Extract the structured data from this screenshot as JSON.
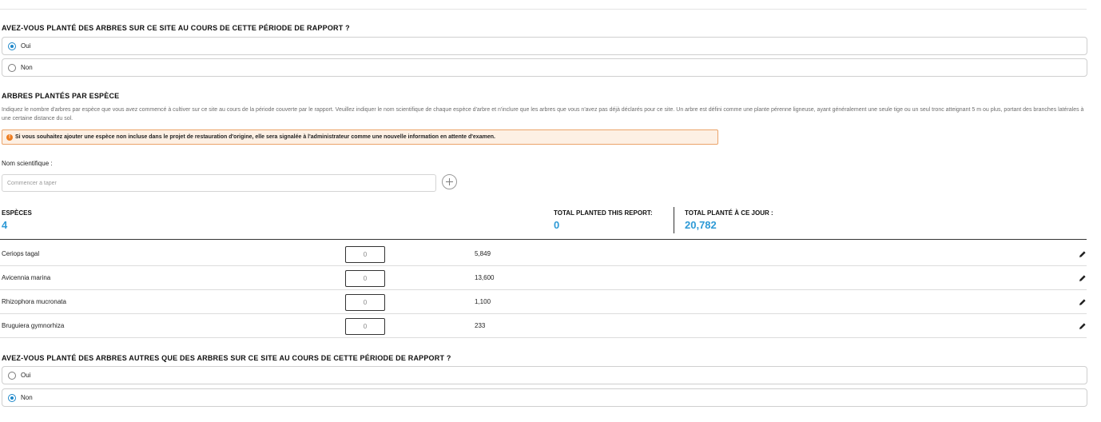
{
  "question1": {
    "title": "AVEZ-VOUS PLANTÉ DES ARBRES SUR CE SITE AU COURS DE CETTE PÉRIODE DE RAPPORT ?",
    "options": [
      {
        "label": "Oui",
        "checked": true
      },
      {
        "label": "Non",
        "checked": false
      }
    ]
  },
  "species_section": {
    "title": "ARBRES PLANTÉS PAR ESPÈCE",
    "description": "Indiquez le nombre d'arbres par espèce que vous avez commencé à cultiver sur ce site au cours de la période couverte par le rapport. Veuillez indiquer le nom scientifique de chaque espèce d'arbre et n'inclure que les arbres que vous n'avez pas déjà déclarés pour ce site. Un arbre est défini comme une plante pérenne ligneuse, ayant généralement une seule tige ou un seul tronc atteignant 5 m ou plus, portant des branches latérales à une certaine distance du sol.",
    "notice": "Si vous souhaitez ajouter une espèce non incluse dans le projet de restauration d'origine, elle sera signalée à l'administrateur comme une nouvelle information en attente d'examen.",
    "notice_icon": "warning-icon",
    "field_label": "Nom scientifique :",
    "search_placeholder": "Commencer à taper",
    "add_icon": "plus-circle-icon"
  },
  "stats": {
    "species_label": "ESPÈCES",
    "species_value": "4",
    "report_label": "TOTAL PLANTED THIS REPORT:",
    "report_value": "0",
    "todate_label": "TOTAL PLANTÉ À CE JOUR :",
    "todate_value": "20,782"
  },
  "species_rows": [
    {
      "name": "Ceriops tagal",
      "input": "0",
      "total": "5,849"
    },
    {
      "name": "Avicennia marina",
      "input": "0",
      "total": "13,600"
    },
    {
      "name": "Rhizophora mucronata",
      "input": "0",
      "total": "1,100"
    },
    {
      "name": "Bruguiera gymnorhiza",
      "input": "0",
      "total": "233"
    }
  ],
  "question2": {
    "title": "AVEZ-VOUS PLANTÉ DES ARBRES AUTRES QUE DES ARBRES SUR CE SITE AU COURS DE CETTE PÉRIODE DE RAPPORT ?",
    "options": [
      {
        "label": "Oui",
        "checked": false
      },
      {
        "label": "Non",
        "checked": true
      }
    ]
  },
  "colors": {
    "accent": "#1d87c9",
    "stat_value": "#2e9ad6",
    "notice_bg": "#fdf0e4",
    "notice_border": "#eba46a",
    "notice_icon": "#ee7d20"
  }
}
